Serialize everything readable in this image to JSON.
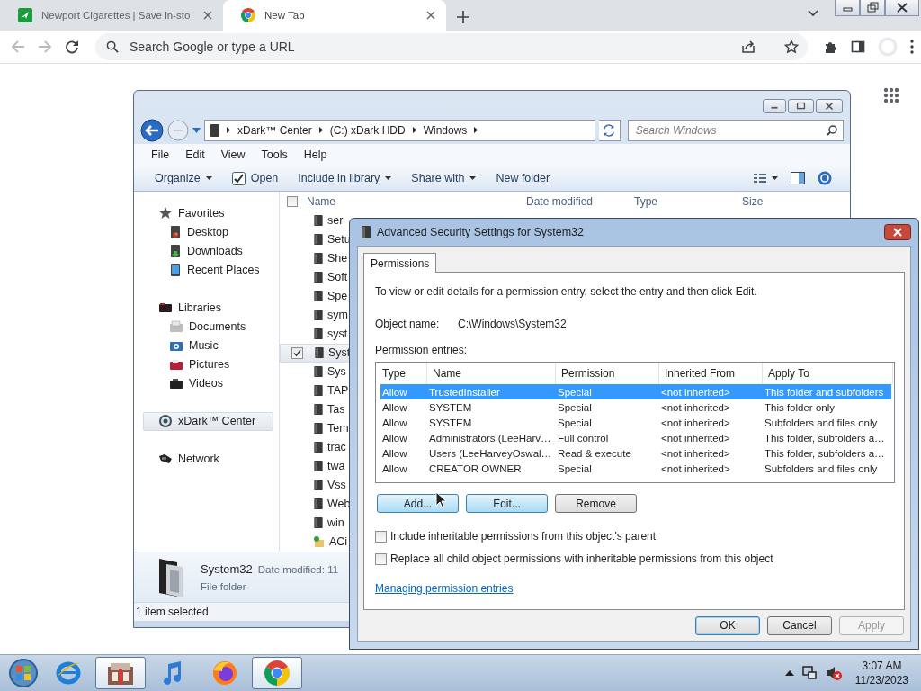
{
  "browser": {
    "tabs": [
      {
        "title": "Newport Cigarettes | Save in-sto",
        "selected": false
      },
      {
        "title": "New Tab",
        "selected": true
      }
    ],
    "omnibox": {
      "placeholder": "Search Google or type a URL"
    }
  },
  "explorer": {
    "breadcrumb": [
      "xDark™ Center",
      "(C:) xDark HDD",
      "Windows"
    ],
    "search": {
      "placeholder": "Search Windows"
    },
    "menu": [
      "File",
      "Edit",
      "View",
      "Tools",
      "Help"
    ],
    "commands": [
      {
        "label": "Organize",
        "kind": "dropdown"
      },
      {
        "label": "Open",
        "kind": "check"
      },
      {
        "label": "Include in library",
        "kind": "dropdown"
      },
      {
        "label": "Share with",
        "kind": "dropdown"
      },
      {
        "label": "New folder",
        "kind": "plain"
      }
    ],
    "nav": [
      {
        "label": "Favorites",
        "selected": false,
        "children": [
          {
            "label": "Desktop",
            "selected": false
          },
          {
            "label": "Downloads",
            "selected": false
          },
          {
            "label": "Recent Places",
            "selected": false
          }
        ]
      },
      {
        "label": "Libraries",
        "selected": false,
        "children": [
          {
            "label": "Documents",
            "selected": false
          },
          {
            "label": "Music",
            "selected": false
          },
          {
            "label": "Pictures",
            "selected": false
          },
          {
            "label": "Videos",
            "selected": false
          }
        ]
      },
      {
        "label": "xDark™ Center",
        "selected": true
      },
      {
        "label": "Network",
        "selected": false
      }
    ],
    "select_all": {
      "checked": false
    },
    "columns": [
      "Name",
      "Date modified",
      "Type",
      "Size"
    ],
    "files": [
      {
        "name": "ser",
        "kind": "folder",
        "selected": false
      },
      {
        "name": "Setu",
        "kind": "folder",
        "selected": false
      },
      {
        "name": "She",
        "kind": "folder",
        "selected": false
      },
      {
        "name": "Soft",
        "kind": "folder",
        "selected": false
      },
      {
        "name": "Spe",
        "kind": "folder",
        "selected": false
      },
      {
        "name": "sym",
        "kind": "folder",
        "selected": false
      },
      {
        "name": "syst",
        "kind": "folder",
        "selected": false
      },
      {
        "name": "Syst",
        "kind": "folder",
        "selected": true
      },
      {
        "name": "Sys",
        "kind": "folder",
        "selected": false
      },
      {
        "name": "TAP",
        "kind": "folder",
        "selected": false
      },
      {
        "name": "Tas",
        "kind": "folder",
        "selected": false
      },
      {
        "name": "Tem",
        "kind": "folder",
        "selected": false
      },
      {
        "name": "trac",
        "kind": "folder",
        "selected": false
      },
      {
        "name": "twa",
        "kind": "folder",
        "selected": false
      },
      {
        "name": "Vss",
        "kind": "folder",
        "selected": false
      },
      {
        "name": "Web",
        "kind": "folder",
        "selected": false
      },
      {
        "name": "win",
        "kind": "folder",
        "selected": false
      },
      {
        "name": "ACi",
        "kind": "shortcut",
        "selected": false
      }
    ],
    "details": {
      "name": "System32",
      "date_label": "Date modified: 11",
      "type": "File folder"
    },
    "status": "1 item selected"
  },
  "dialog": {
    "title": "Advanced Security Settings for System32",
    "tabs": [
      {
        "label": "Permissions",
        "selected": true
      }
    ],
    "intro": "To view or edit details for a permission entry, select the entry and then click Edit.",
    "object_label": "Object name:",
    "object_name": "C:\\Windows\\System32",
    "entries_label": "Permission entries:",
    "columns": [
      "Type",
      "Name",
      "Permission",
      "Inherited From",
      "Apply To"
    ],
    "rows": [
      {
        "cells": [
          "Allow",
          "TrustedInstaller",
          "Special",
          "<not inherited>",
          "This folder and subfolders"
        ],
        "selected": true
      },
      {
        "cells": [
          "Allow",
          "SYSTEM",
          "Special",
          "<not inherited>",
          "This folder only"
        ],
        "selected": false
      },
      {
        "cells": [
          "Allow",
          "SYSTEM",
          "Special",
          "<not inherited>",
          "Subfolders and files only"
        ],
        "selected": false
      },
      {
        "cells": [
          "Allow",
          "Administrators (LeeHarv…",
          "Full control",
          "<not inherited>",
          "This folder, subfolders a…"
        ],
        "selected": false
      },
      {
        "cells": [
          "Allow",
          "Users (LeeHarveyOswal…",
          "Read & execute",
          "<not inherited>",
          "This folder, subfolders a…"
        ],
        "selected": false
      },
      {
        "cells": [
          "Allow",
          "CREATOR OWNER",
          "Special",
          "<not inherited>",
          "Subfolders and files only"
        ],
        "selected": false
      }
    ],
    "actions": [
      "Add...",
      "Edit...",
      "Remove"
    ],
    "options": [
      {
        "label": "Include inheritable permissions from this object's parent",
        "checked": false
      },
      {
        "label": "Replace all child object permissions with inheritable permissions from this object",
        "checked": false
      }
    ],
    "link": "Managing permission entries",
    "footer": [
      {
        "label": "OK",
        "default": true,
        "disabled": false
      },
      {
        "label": "Cancel",
        "default": false,
        "disabled": false
      },
      {
        "label": "Apply",
        "default": false,
        "disabled": true
      }
    ]
  },
  "taskbar": {
    "apps": [
      {
        "active": false
      },
      {
        "active": true
      },
      {
        "active": false
      },
      {
        "active": false
      },
      {
        "active": true
      }
    ],
    "time": "3:07 AM",
    "date": "11/23/2023"
  }
}
